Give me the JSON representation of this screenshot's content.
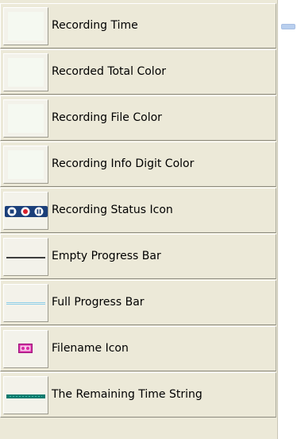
{
  "items": [
    {
      "label": "Recording Time",
      "preview": "color-swatch",
      "swatch_color": "#f5f9f1"
    },
    {
      "label": "Recorded Total Color",
      "preview": "color-swatch",
      "swatch_color": "#f5f9f1"
    },
    {
      "label": "Recording File Color",
      "preview": "color-swatch",
      "swatch_color": "#f5f9f1"
    },
    {
      "label": "Recording Info Digit Color",
      "preview": "color-swatch",
      "swatch_color": "#f5f9f1"
    },
    {
      "label": "Recording Status Icon",
      "preview": "recording-status-icon"
    },
    {
      "label": "Empty Progress Bar",
      "preview": "empty-progress-bar-icon",
      "line_color": "#3d3d3d"
    },
    {
      "label": "Full Progress Bar",
      "preview": "full-progress-bar-icon",
      "line_color": "#8ecfe9"
    },
    {
      "label": "Filename Icon",
      "preview": "filename-icon",
      "icon_color": "#d62aa4"
    },
    {
      "label": "The Remaining Time String",
      "preview": "remaining-time-string-icon",
      "icon_color": "#0f7a6e"
    }
  ]
}
